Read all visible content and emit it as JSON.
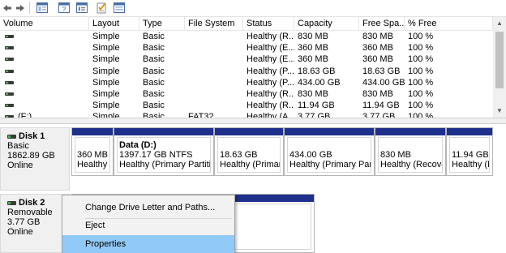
{
  "toolbar": {
    "buttons": [
      {
        "name": "back-arrow-icon"
      },
      {
        "name": "forward-arrow-icon"
      },
      {
        "name": "console-tree-icon"
      },
      {
        "name": "help-icon"
      },
      {
        "name": "properties-icon"
      },
      {
        "name": "checklist-icon"
      },
      {
        "name": "view-icon"
      }
    ],
    "help_glyph": "?"
  },
  "volume_list": {
    "columns": [
      "Volume",
      "Layout",
      "Type",
      "File System",
      "Status",
      "Capacity",
      "Free Spa...",
      "% Free"
    ],
    "rows": [
      [
        "",
        "Simple",
        "Basic",
        "",
        "Healthy (R...",
        "830 MB",
        "830 MB",
        "100 %"
      ],
      [
        "",
        "Simple",
        "Basic",
        "",
        "Healthy (E...",
        "360 MB",
        "360 MB",
        "100 %"
      ],
      [
        "",
        "Simple",
        "Basic",
        "",
        "Healthy (E...",
        "360 MB",
        "360 MB",
        "100 %"
      ],
      [
        "",
        "Simple",
        "Basic",
        "",
        "Healthy (P...",
        "18.63 GB",
        "18.63 GB",
        "100 %"
      ],
      [
        "",
        "Simple",
        "Basic",
        "",
        "Healthy (P...",
        "434.00 GB",
        "434.00 GB",
        "100 %"
      ],
      [
        "",
        "Simple",
        "Basic",
        "",
        "Healthy (R...",
        "830 MB",
        "830 MB",
        "100 %"
      ],
      [
        "",
        "Simple",
        "Basic",
        "",
        "Healthy (R...",
        "11.94 GB",
        "11.94 GB",
        "100 %"
      ]
    ],
    "partial_row": [
      "(F:)",
      "Simple",
      "Basic",
      "FAT32",
      "Healthy (A...",
      "3.77 GB",
      "3.77 GB",
      "100 %"
    ]
  },
  "disks": [
    {
      "name": "Disk 1",
      "type": "Basic",
      "size": "1862.89 GB",
      "status": "Online",
      "partitions": [
        {
          "name": "",
          "line1": "360 MB",
          "line2": "Healthy (EFI System Partition)"
        },
        {
          "name": "Data  (D:)",
          "line1": "1397.17 GB NTFS",
          "line2": "Healthy (Primary Partition)"
        },
        {
          "name": "",
          "line1": "18.63 GB",
          "line2": "Healthy (Primary Partition)"
        },
        {
          "name": "",
          "line1": "434.00 GB",
          "line2": "Healthy (Primary Partition)"
        },
        {
          "name": "",
          "line1": "830 MB",
          "line2": "Healthy (Recovery Partition)"
        },
        {
          "name": "",
          "line1": "11.94 GB",
          "line2": "Healthy (Recovery Partition)"
        }
      ]
    },
    {
      "name": "Disk 2",
      "type": "Removable",
      "size": "3.77 GB",
      "status": "Online"
    }
  ],
  "context_menu": {
    "items": [
      {
        "label": "Change Drive Letter and Paths...",
        "selected": false
      },
      {
        "label": "Eject",
        "selected": false
      },
      {
        "label": "Properties",
        "selected": true
      }
    ]
  },
  "colors": {
    "partition_bar": "#1f2f8c",
    "menu_highlight": "#91c9f7",
    "volume_icon_green": "#4fb34f"
  }
}
